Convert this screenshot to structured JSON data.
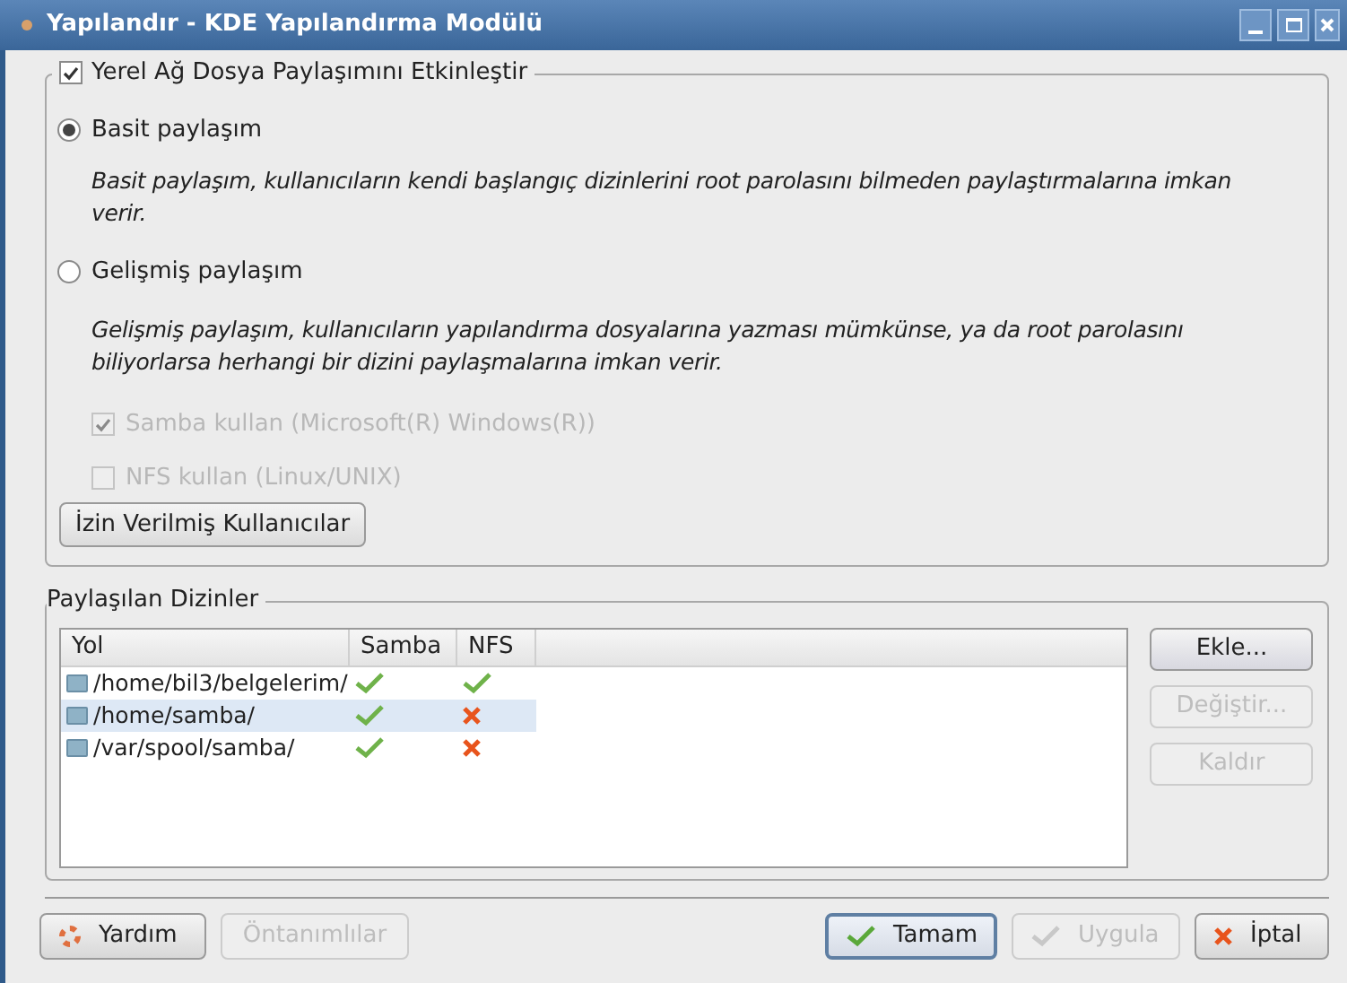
{
  "window": {
    "title": "Yapılandır - KDE Yapılandırma Modülü"
  },
  "sharing_group": {
    "label": "Yerel Ağ Dosya Paylaşımını Etkinleştir",
    "checked": true
  },
  "modes": [
    {
      "label": "Basit paylaşım",
      "selected": true,
      "description": "Basit paylaşım, kullanıcıların kendi başlangıç dizinlerini root parolasını bilmeden paylaştırmalarına imkan verir."
    },
    {
      "label": "Gelişmiş paylaşım",
      "selected": false,
      "description": "Gelişmiş paylaşım, kullanıcıların yapılandırma dosyalarına yazması mümkünse, ya da root parolasını biliyorlarsa herhangi bir dizini paylaşmalarına imkan verir."
    }
  ],
  "options": [
    {
      "label": "Samba kullan (Microsoft(R) Windows(R))",
      "checked": true,
      "disabled": true
    },
    {
      "label": "NFS kullan (Linux/UNIX)",
      "checked": false,
      "disabled": true
    }
  ],
  "users_button": "İzin Verilmiş Kullanıcılar",
  "shared_dirs": {
    "title": "Paylaşılan Dizinler",
    "columns": [
      "Yol",
      "Samba",
      "NFS"
    ],
    "rows": [
      {
        "path": "/home/bil3/belgelerim/",
        "samba": true,
        "nfs": true,
        "selected": false
      },
      {
        "path": "/home/samba/",
        "samba": true,
        "nfs": false,
        "selected": true
      },
      {
        "path": "/var/spool/samba/",
        "samba": true,
        "nfs": false,
        "selected": false
      }
    ],
    "buttons": [
      {
        "label": "Ekle...",
        "disabled": false
      },
      {
        "label": "Değiştir...",
        "disabled": true
      },
      {
        "label": "Kaldır",
        "disabled": true
      }
    ]
  },
  "footer_buttons": [
    {
      "label": "Yardım",
      "kind": "help",
      "disabled": false,
      "default": false
    },
    {
      "label": "Öntanımlılar",
      "kind": "plain",
      "disabled": true,
      "default": false
    },
    {
      "label": "Tamam",
      "kind": "check",
      "disabled": false,
      "default": true
    },
    {
      "label": "Uygula",
      "kind": "check",
      "disabled": true,
      "default": false
    },
    {
      "label": "İptal",
      "kind": "cross",
      "disabled": false,
      "default": false
    }
  ]
}
